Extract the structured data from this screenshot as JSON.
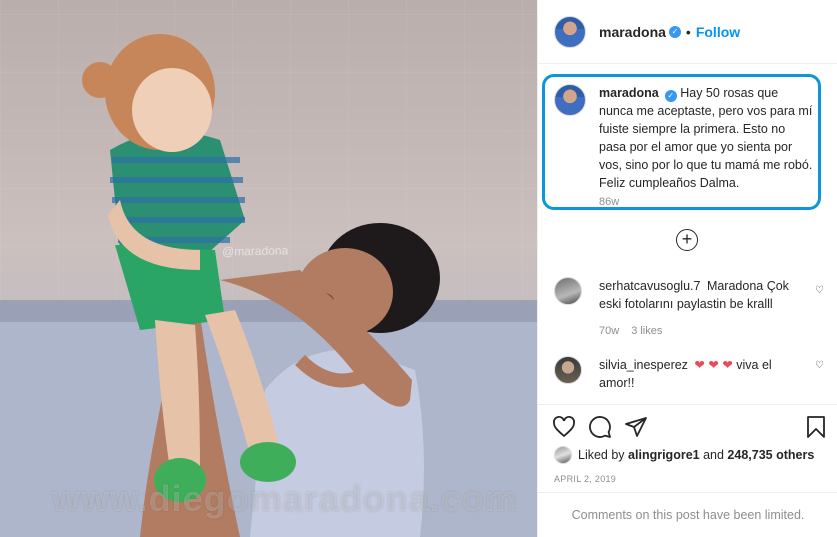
{
  "header": {
    "username": "maradona",
    "dot": "•",
    "follow_label": "Follow"
  },
  "caption": {
    "username": "maradona",
    "text": "Hay 50 rosas que nunca me aceptaste, pero vos para mí fuiste siempre la primera. Esto no pasa por el amor que yo sienta por vos, sino por lo que tu mamá me robó. Feliz cumpleaños Dalma.",
    "time": "86w"
  },
  "comments": [
    {
      "username": "serhatcavusoglu.7",
      "text": "Maradona Çok eski fotolarını paylastin be kralll",
      "time": "70w",
      "likes": "3 likes"
    },
    {
      "username": "silvia_inesperez",
      "hearts": "❤ ❤ ❤",
      "text": "viva el amor!!"
    }
  ],
  "likes": {
    "prefix": "Liked by",
    "user": "alingrigore1",
    "conj": "and",
    "others": "248,735 others"
  },
  "date": "APRIL 2, 2019",
  "comments_limited": "Comments on this post have been limited.",
  "photo": {
    "watermark_small": "@maradona",
    "watermark_large": "www.diegomaradona.com"
  },
  "colors": {
    "accent_blue": "#0095f6",
    "highlight_border": "#0d97d9",
    "verified": "#3897f0",
    "heart_red": "#ed4956"
  },
  "icons": [
    "plus-circle-icon",
    "heart-icon",
    "comment-icon",
    "share-icon",
    "bookmark-icon",
    "verified-icon"
  ]
}
